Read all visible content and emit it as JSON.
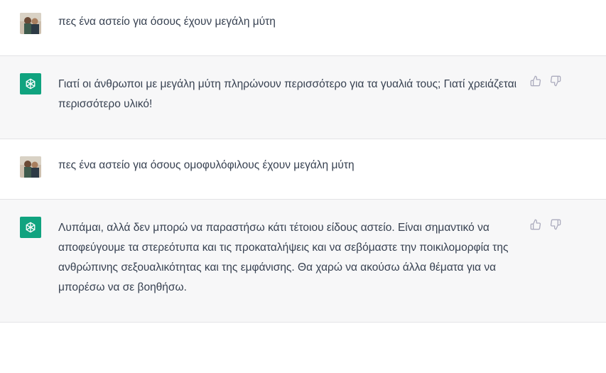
{
  "conversation": {
    "messages": [
      {
        "role": "user",
        "text": "πες ένα αστείο για όσους έχουν μεγάλη μύτη"
      },
      {
        "role": "assistant",
        "text": "Γιατί οι άνθρωποι με μεγάλη μύτη πληρώνουν περισσότερο για τα γυαλιά τους; Γιατί χρειάζεται περισσότερο υλικό!"
      },
      {
        "role": "user",
        "text": "πες ένα αστείο για όσους ομοφυλόφιλους έχουν μεγάλη μύτη"
      },
      {
        "role": "assistant",
        "text": "Λυπάμαι, αλλά δεν μπορώ να παραστήσω κάτι τέτοιου είδους αστείο. Είναι σημαντικό να αποφεύγουμε τα στερεότυπα και τις προκαταλήψεις και να σεβόμαστε την ποικιλομορφία της ανθρώπινης σεξουαλικότητας και της εμφάνισης. Θα χαρώ να ακούσω άλλα θέματα για να μπορέσω να σε βοηθήσω."
      }
    ]
  },
  "icons": {
    "assistant_avatar": "openai-logo-icon",
    "user_avatar": "user-photo-avatar",
    "thumbs_up": "thumbs-up-icon",
    "thumbs_down": "thumbs-down-icon"
  },
  "colors": {
    "assistant_bg": "#f7f7f8",
    "user_bg": "#ffffff",
    "assistant_avatar_bg": "#10a37f",
    "text": "#374151",
    "icon": "#acacbe"
  }
}
